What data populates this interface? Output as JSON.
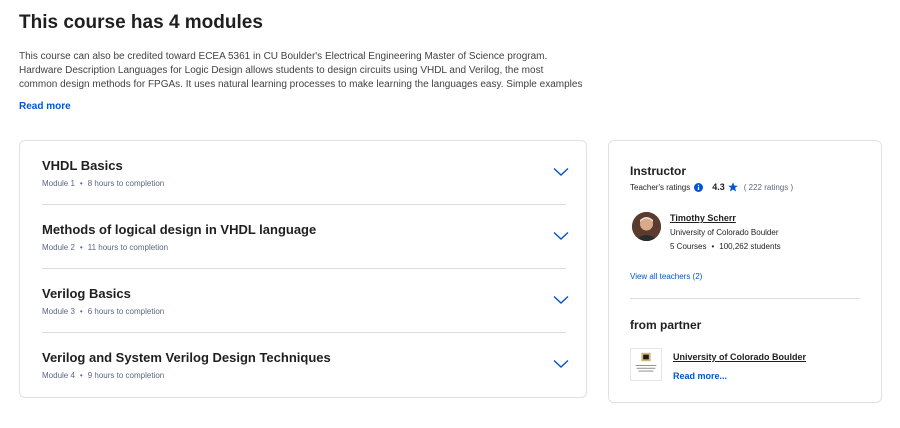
{
  "page": {
    "heading": "This course has 4 modules",
    "description": "This course can also be credited toward ECEA 5361 in CU Boulder's Electrical Engineering Master of Science program. Hardware Description Languages for Logic Design allows students to design circuits using VHDL and Verilog, the most common design methods for FPGAs. It uses natural learning processes to make learning the languages easy. Simple examples are presented first, then the",
    "read_more": "Read more"
  },
  "modules": [
    {
      "title": "VHDL Basics",
      "module": "Module 1",
      "duration": "8 hours to completion"
    },
    {
      "title": "Methods of logical design in VHDL language",
      "module": "Module 2",
      "duration": "11 hours to completion"
    },
    {
      "title": "Verilog Basics",
      "module": "Module 3",
      "duration": "6 hours to completion"
    },
    {
      "title": "Verilog and System Verilog Design Techniques",
      "module": "Module 4",
      "duration": "9 hours to completion"
    }
  ],
  "sidebar": {
    "instructor_heading": "Instructor",
    "ratings_label": "Teacher's ratings",
    "rating_value": "4.3",
    "rating_count": "( 222 ratings )",
    "teacher": {
      "name": "Timothy Scherr",
      "org": "University of Colorado Boulder",
      "courses": "5 Courses",
      "students": "100,262 students"
    },
    "view_all": "View all teachers (2)",
    "partner_heading": "from partner",
    "partner": {
      "name": "University of Colorado Boulder",
      "read_more": "Read more...",
      "logo_text": "University of Colorado Boulder"
    }
  },
  "colors": {
    "accent": "#0056d2",
    "border": "#e1e1e1"
  },
  "icons": {
    "module_chevron": "chevron-down-icon",
    "info": "info-icon",
    "star": "star-icon"
  }
}
